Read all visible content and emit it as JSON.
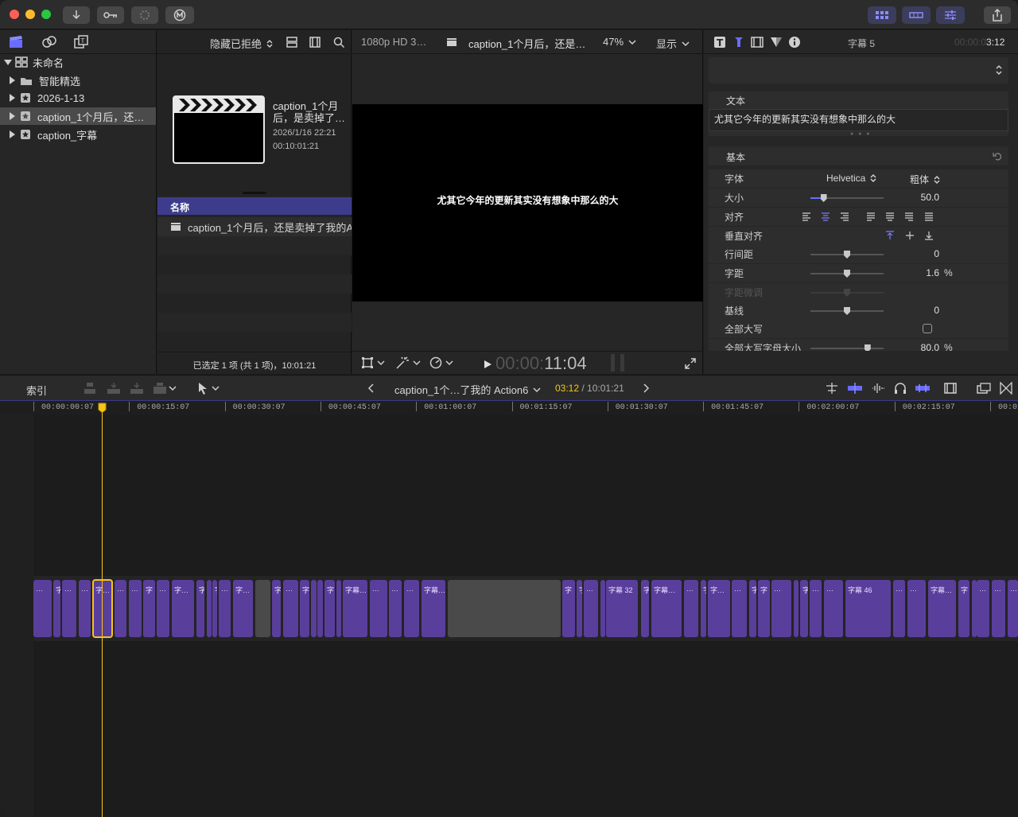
{
  "browser": {
    "filter_label": "隐藏已拒绝",
    "clip_title": "caption_1个月后，是卖掉了…Action",
    "clip_date": "2026/1/16 22:21",
    "clip_duration": "00:10:01:21",
    "column_name": "名称",
    "list_row": "caption_1个月后，还是卖掉了我的A",
    "status": "已选定 1 项 (共 1 项)，10:01:21"
  },
  "library": {
    "root": "未命名",
    "items": [
      "智能精选",
      "2026-1-13",
      "caption_1个月后，还…",
      "caption_字幕"
    ]
  },
  "viewer": {
    "format": "1080p HD 3…",
    "clip": "caption_1个月后，还是…",
    "zoom": "47%",
    "display": "显示",
    "caption_text": "尤其它今年的更新其实没有想象中那么的大",
    "timecode_dim": "00:00:",
    "timecode": "11:04"
  },
  "inspector": {
    "title": "字幕 5",
    "time_dim": "00:00:0",
    "time": "3:12",
    "text_section": "文本",
    "text_value": "尤其它今年的更新其实没有想象中那么的大",
    "basic_section": "基本",
    "font_label": "字体",
    "font_value": "Helvetica",
    "weight_value": "粗体",
    "size_label": "大小",
    "size_value": "50.0",
    "size_level": 0.18,
    "align_label": "对齐",
    "valign_label": "垂直对齐",
    "line_label": "行间距",
    "line_value": "0",
    "line_level": 0.5,
    "track_label": "字距",
    "track_value": "1.6",
    "track_unit": "%",
    "track_level": 0.5,
    "kern_label": "字距微调",
    "kern_level": 0.5,
    "base_label": "基线",
    "base_value": "0",
    "base_level": 0.5,
    "caps_label": "全部大写",
    "capsize_label": "全部大写字母大小",
    "capsize_value": "80.0",
    "capsize_unit": "%",
    "capsize_level": 0.78
  },
  "timeline": {
    "index_label": "索引",
    "project": "caption_1个…了我的 Action6",
    "time_current": "03:12",
    "time_sep": " / ",
    "time_total": "10:01:21",
    "ruler_labels": [
      "00:00:00:07",
      "00:00:15:07",
      "00:00:30:07",
      "00:00:45:07",
      "00:01:00:07",
      "00:01:15:07",
      "00:01:30:07",
      "00:01:45:07",
      "00:02:00:07",
      "00:02:15:07",
      "00:02"
    ],
    "clip_texts": {
      "selected": "字…",
      "c_ze": "字",
      "c_zemu": "字…",
      "c_zemu2": "字幕…",
      "c32": "字幕 32",
      "c46": "字幕 46",
      "dots": "…"
    }
  },
  "colors": {
    "accent": "#5a3e9c",
    "selection": "#f5c518",
    "column_header": "#3d3c8c"
  }
}
